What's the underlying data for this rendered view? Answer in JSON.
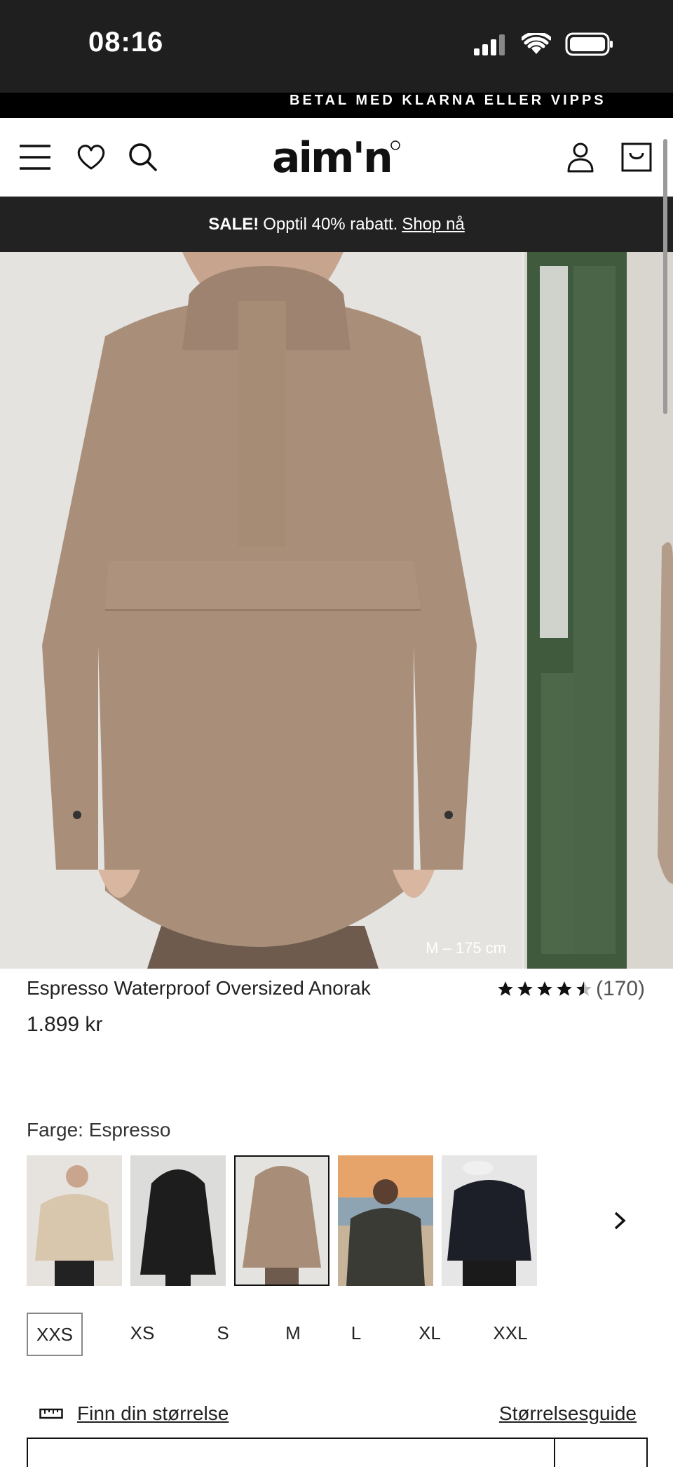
{
  "status_bar": {
    "time": "08:16"
  },
  "promo_top": {
    "text": "BETAL MED KLARNA ELLER VIPPS"
  },
  "header": {
    "logo_text": "aim'n"
  },
  "sale_banner": {
    "bold": "SALE!",
    "text": "Opptil 40% rabatt.",
    "link": "Shop nå"
  },
  "gallery": {
    "caption": "M – 175 cm"
  },
  "product": {
    "title": "Espresso Waterproof Oversized Anorak",
    "price": "1.899 kr",
    "rating_value": 4.5,
    "rating_count": "(170)"
  },
  "color": {
    "label": "Farge: Espresso",
    "swatches": [
      {
        "color": "#d8c7ad",
        "name": "beige"
      },
      {
        "color": "#1d1d1d",
        "name": "black"
      },
      {
        "color": "#a88e78",
        "name": "espresso",
        "selected": true
      },
      {
        "color": "#3a3b34",
        "name": "dark-olive"
      },
      {
        "color": "#1c1f28",
        "name": "navy"
      }
    ]
  },
  "sizes": {
    "options": [
      "XXS",
      "XS",
      "S",
      "M",
      "L",
      "XL",
      "XXL"
    ],
    "selected": "XXS"
  },
  "size_links": {
    "finn": "Finn din størrelse",
    "guide": "Størrelsesguide"
  }
}
